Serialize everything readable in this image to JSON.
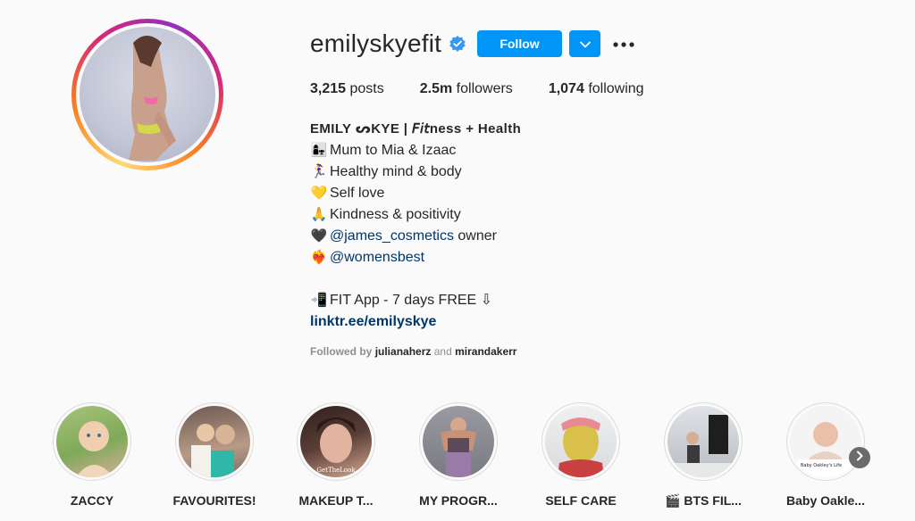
{
  "profile": {
    "username": "emilyskyefit",
    "follow_label": "Follow",
    "stats": {
      "posts_count": "3,215",
      "posts_label": "posts",
      "followers_count": "2.5m",
      "followers_label": "followers",
      "following_count": "1,074",
      "following_label": "following"
    },
    "bio": {
      "name": "ΕMILY ᔕKYE | 𝘍𝘪𝘵ness + Health",
      "lines": [
        {
          "emoji": "👩‍👧",
          "text": "Mum to Mia & Izaac"
        },
        {
          "emoji": "🏃‍♀️",
          "text": "Healthy mind & body"
        },
        {
          "emoji": "💛",
          "text": "Self love"
        },
        {
          "emoji": "🙏",
          "text": "Kindness & positivity"
        },
        {
          "emoji": "🖤",
          "mention": "@james_cosmetics",
          "text": " owner"
        },
        {
          "emoji": "❤️‍🔥",
          "mention": "@womensbest"
        }
      ],
      "app_emoji": "📲",
      "app_text": "FIT App - 7 days FREE ⇩",
      "link": "linktr.ee/emilyskye"
    },
    "followed_by": {
      "prefix": "Followed by",
      "user1": "julianaherz",
      "and": "and",
      "user2": "mirandakerr"
    }
  },
  "highlights": [
    {
      "label": "ZACCY",
      "colors": [
        "#8fbf6a",
        "#e9c8a8"
      ]
    },
    {
      "label": "FAVOURITES!",
      "colors": [
        "#6a5a52",
        "#d8b8a0"
      ]
    },
    {
      "label": "MAKEUP T...",
      "colors": [
        "#3a2a26",
        "#e0b8a8"
      ],
      "overlay_text": "GetTheLook"
    },
    {
      "label": "MY PROGR...",
      "colors": [
        "#8a8a92",
        "#9a7aa8"
      ]
    },
    {
      "label": "SELF CARE",
      "colors": [
        "#d8c04a",
        "#c94040"
      ]
    },
    {
      "label": "🎬 BTS FIL...",
      "colors": [
        "#2a2a2a",
        "#9aa0a8"
      ]
    },
    {
      "label": "Baby Oakle...",
      "colors": [
        "#f2f2f2",
        "#e8c0b0"
      ],
      "overlay_text": "Baby Oakley's Life"
    }
  ],
  "colors": {
    "primary": "#0095f6",
    "text": "#262626",
    "muted": "#8e8e8e",
    "link": "#00376b",
    "background": "#fafafa"
  }
}
